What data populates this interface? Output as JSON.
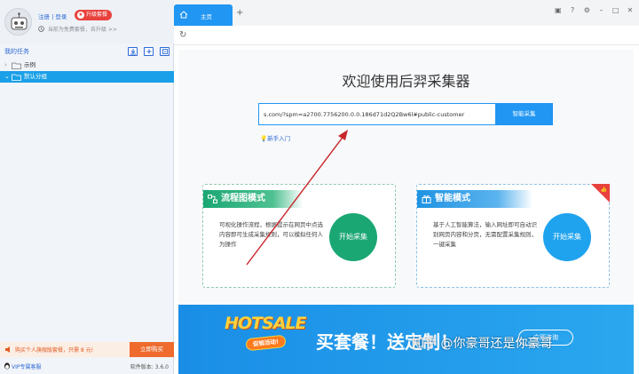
{
  "sidebar": {
    "auth_register": "注册",
    "auth_sep": "|",
    "auth_login": "登录",
    "upgrade_label": "升级套餐",
    "plan_text": "当前为免费套餐，去升级 >>",
    "tasks_title": "我的任务",
    "tree": [
      {
        "label": "示例",
        "expanded": false,
        "selected": false
      },
      {
        "label": "默认分组",
        "expanded": true,
        "selected": true
      }
    ],
    "promo_text": "购买个人旗舰版套餐，只需 8 元!",
    "promo_button": "立即购买",
    "vip_link": "VIP专属客服",
    "version": "软件版本: 3.6.0"
  },
  "tabs": {
    "home_label": "主页",
    "add_label": "+"
  },
  "main": {
    "welcome": "欢迎使用后羿采集器",
    "url_value": "s.com/?spm=a2700.7756200.0.0.186d71d2Q2Bw6l#public-customer",
    "collect_button": "智能采集",
    "newbie_link": "新手入门",
    "cards": {
      "flow": {
        "title": "流程图模式",
        "desc": "可视化操作流程，根据提示在网页中点选内容即可生成采集规则，可以模拟任何人为操作",
        "button": "开始采集"
      },
      "smart": {
        "title": "智能模式",
        "desc": "基于人工智能算法，输入网址即可自动识别网页内容和分页，无需配置采集规则，一键采集",
        "button": "开始采集"
      }
    },
    "banner": {
      "hot_word": "HOTSALE",
      "sale_tag": "促销活动!",
      "slogan": "买套餐！送定制！",
      "consult_button": "立即咨询"
    },
    "watermark": "知乎 @你豪哥还是你豪哥"
  },
  "colors": {
    "accent": "#2196f3",
    "green": "#1aa774",
    "red": "#e8413d",
    "orange": "#ee6b2d"
  },
  "icons": [
    "home-icon",
    "refresh-icon",
    "folder-icon",
    "robot-avatar-icon",
    "clock-icon",
    "flowchart-icon",
    "gift-icon",
    "lightbulb-icon",
    "thumb-up-icon"
  ]
}
